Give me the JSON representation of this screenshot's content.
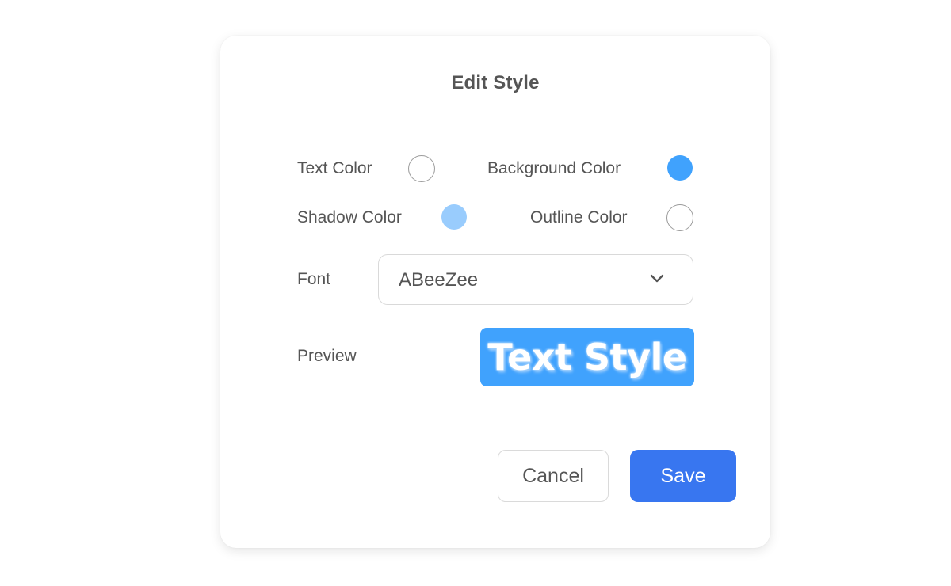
{
  "dialog": {
    "title": "Edit Style",
    "colors": {
      "text_color": {
        "label": "Text Color",
        "value": "#FFFFFF"
      },
      "background_color": {
        "label": "Background Color",
        "value": "#40A2FD"
      },
      "shadow_color": {
        "label": "Shadow Color",
        "value": "#99CCFD"
      },
      "outline_color": {
        "label": "Outline Color",
        "value": "#FFFFFF"
      }
    },
    "font": {
      "label": "Font",
      "selected": "ABeeZee",
      "icon": "chevron-down-icon"
    },
    "preview": {
      "label": "Preview",
      "sample_text": "Text Style"
    },
    "buttons": {
      "cancel_label": "Cancel",
      "save_label": "Save",
      "save_color": "#3876F0"
    }
  }
}
